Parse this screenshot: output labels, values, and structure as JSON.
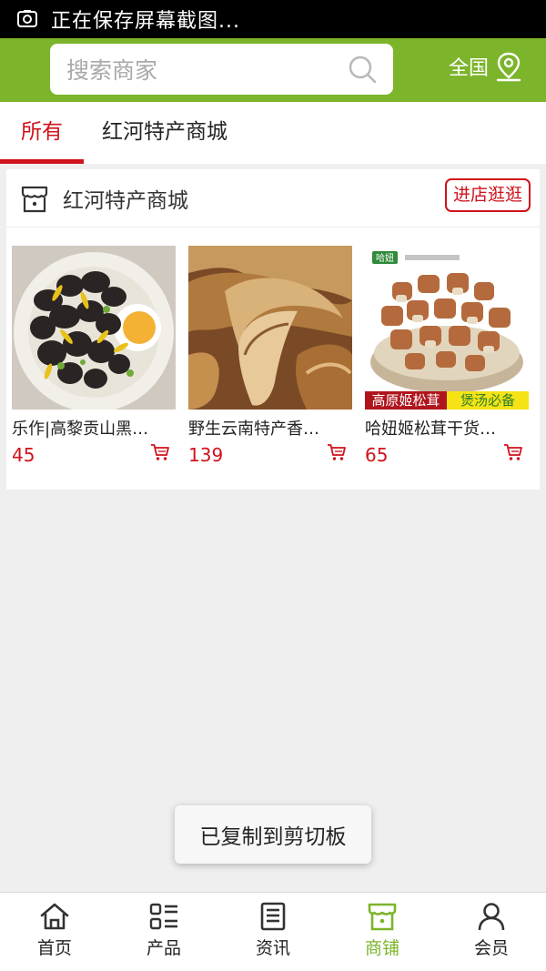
{
  "status_bar": {
    "text": "正在保存屏幕截图..."
  },
  "header": {
    "search_placeholder": "搜索商家",
    "region_label": "全国"
  },
  "tabs": [
    {
      "label": "所有",
      "active": true
    },
    {
      "label": "红河特产商城",
      "active": false
    }
  ],
  "store": {
    "name": "红河特产商城",
    "enter_label": "进店逛逛",
    "products": [
      {
        "name": "乐作|高黎贡山黑…",
        "price": "45"
      },
      {
        "name": "野生云南特产香…",
        "price": "139"
      },
      {
        "name": "哈妞姬松茸干货…",
        "price": "65",
        "banner_left": "高原姬松茸",
        "banner_right": "煲汤必备",
        "logo_text": "哈妞"
      }
    ]
  },
  "toast": {
    "text": "已复制到剪切板"
  },
  "bottom_nav": [
    {
      "label": "首页",
      "icon": "home-icon",
      "active": false
    },
    {
      "label": "产品",
      "icon": "product-list-icon",
      "active": false
    },
    {
      "label": "资讯",
      "icon": "news-icon",
      "active": false
    },
    {
      "label": "商铺",
      "icon": "shop-icon",
      "active": true
    },
    {
      "label": "会员",
      "icon": "member-icon",
      "active": false
    }
  ],
  "colors": {
    "brand_green": "#7cb42b",
    "accent_red": "#d0121b"
  }
}
